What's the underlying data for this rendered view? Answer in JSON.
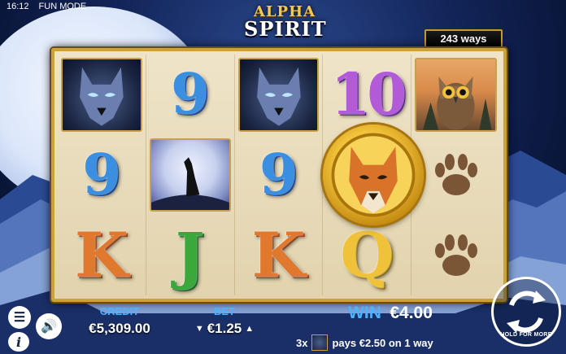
{
  "status": {
    "time": "16:12",
    "mode": "FUN MODE"
  },
  "logo": {
    "line1": "ALPHA",
    "line2": "SPIRIT"
  },
  "ways": "243 ways",
  "reels": {
    "rows": [
      [
        "wolf",
        "nine",
        "wolf",
        "ten",
        "owl"
      ],
      [
        "nine",
        "wild",
        "nine",
        "coin-wolf",
        "paw"
      ],
      [
        "k",
        "j",
        "k",
        "q",
        "paw"
      ]
    ],
    "glyphs": {
      "nine": "9",
      "ten": "10",
      "k": "K",
      "j": "J",
      "q": "Q"
    }
  },
  "credit": {
    "label": "CREDIT",
    "value": "€5,309.00"
  },
  "bet": {
    "label": "BET",
    "value": "€1.25"
  },
  "win": {
    "label": "WIN",
    "value": "€4.00"
  },
  "payline": {
    "count": "3x",
    "text": "pays €2.50 on 1 way"
  },
  "spin": {
    "caption": "HOLD FOR MORE"
  },
  "colors": {
    "credit_label": "#4db3ff",
    "frame_gold": "#c9a23a"
  }
}
